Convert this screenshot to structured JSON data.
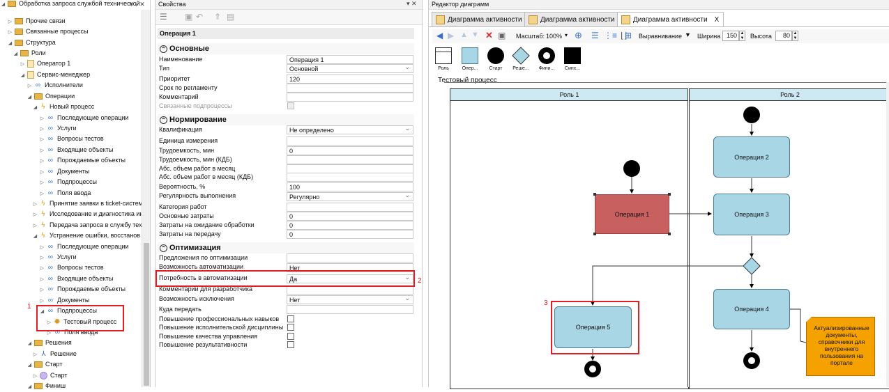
{
  "tree": {
    "top_cut": "Обработка запроса службой технической п",
    "items": [
      {
        "label": "Прочие связи"
      },
      {
        "label": "Связанные процессы"
      },
      {
        "label": "Структура"
      },
      {
        "label": "Роли"
      },
      {
        "label": "Оператор 1"
      },
      {
        "label": "Сервис-менеджер"
      },
      {
        "label": "Исполнители"
      },
      {
        "label": "Операции"
      },
      {
        "label": "Новый процесс"
      },
      {
        "label": "Последующие операции"
      },
      {
        "label": "Услуги"
      },
      {
        "label": "Вопросы тестов"
      },
      {
        "label": "Входящие объекты"
      },
      {
        "label": "Порождаемые объекты"
      },
      {
        "label": "Документы"
      },
      {
        "label": "Подпроцессы"
      },
      {
        "label": "Поля ввода"
      },
      {
        "label": "Принятие заявки в ticket-систем"
      },
      {
        "label": "Исследование и диагностика ин"
      },
      {
        "label": "Передача запроса в службу тех"
      },
      {
        "label": "Устранение ошибки, восстанов"
      },
      {
        "label": "Последующие операции"
      },
      {
        "label": "Услуги"
      },
      {
        "label": "Вопросы тестов"
      },
      {
        "label": "Входящие объекты"
      },
      {
        "label": "Порождаемые объекты"
      },
      {
        "label": "Документы"
      },
      {
        "label": "Подпроцессы"
      },
      {
        "label": "Тестовый процесс"
      },
      {
        "label": "Поля ввода"
      },
      {
        "label": "Решения"
      },
      {
        "label": "Решение"
      },
      {
        "label": "Старт"
      },
      {
        "label": "Старт"
      },
      {
        "label": "Финиш"
      }
    ]
  },
  "annotations": {
    "n1": "1",
    "n2": "2",
    "n3": "3"
  },
  "props": {
    "title": "Свойства",
    "object_name": "Операция 1",
    "sections": {
      "basic": "Основные",
      "norm": "Нормирование",
      "opt": "Оптимизация"
    },
    "basic": [
      {
        "label": "Наименование",
        "value": "Операция 1"
      },
      {
        "label": "Тип",
        "value": "Основной"
      },
      {
        "label": "Приоритет",
        "value": "120"
      },
      {
        "label": "Срок по регламенту",
        "value": ""
      },
      {
        "label": "Комментарий",
        "value": ""
      },
      {
        "label": "Связанные подпроцессы",
        "value": ""
      }
    ],
    "norm": [
      {
        "label": "Квалификация",
        "value": "Не определено"
      },
      {
        "label": "Единица измерения",
        "value": ""
      },
      {
        "label": "Трудоемкость, мин",
        "value": "0"
      },
      {
        "label": "Трудоемкость, мин (КДБ)",
        "value": ""
      },
      {
        "label": "Абс. объем работ в месяц",
        "value": ""
      },
      {
        "label": "Абс. объем работ в месяц (КДБ)",
        "value": ""
      },
      {
        "label": "Вероятность, %",
        "value": "100"
      },
      {
        "label": "Регулярность выполнения",
        "value": "Регулярно"
      },
      {
        "label": "Категория работ",
        "value": ""
      },
      {
        "label": "Основные затраты",
        "value": "0"
      },
      {
        "label": "Затраты на ожидание обработки",
        "value": "0"
      },
      {
        "label": "Затраты на передачу",
        "value": "0"
      }
    ],
    "opt": [
      {
        "label": "Предложения по оптимизации",
        "value": ""
      },
      {
        "label": "Возможность автоматизации",
        "value": "Нет"
      },
      {
        "label": "Потребность в автоматизации",
        "value": "Да"
      },
      {
        "label": "Комментарии для разработчика",
        "value": ""
      },
      {
        "label": "Возможность исключения",
        "value": "Нет"
      },
      {
        "label": "Куда передать",
        "value": ""
      },
      {
        "label": "Повышение профессиональных навыков",
        "value": ""
      },
      {
        "label": "Повышение исполнительской дисциплины",
        "value": ""
      },
      {
        "label": "Повышение качества управления",
        "value": ""
      },
      {
        "label": "Повышение результативности",
        "value": ""
      }
    ]
  },
  "editor": {
    "title": "Редактор диаграмм",
    "tabs": [
      {
        "label": "Диаграмма активности",
        "close": "X"
      },
      {
        "label": "Диаграмма активности",
        "close": "X"
      },
      {
        "label": "Диаграмма активности",
        "close": "X"
      }
    ],
    "toolbar": {
      "scale_label": "Масштаб:",
      "scale_value": "100%",
      "align_label": "Выравнивание",
      "width_label": "Ширина",
      "width_value": "150",
      "height_label": "Высота",
      "height_value": "80"
    },
    "palette": [
      "Роль",
      "Опер...",
      "Старт",
      "Реше...",
      "Фини...",
      "Синх..."
    ],
    "diagram": {
      "title": "Тестовый процесс",
      "lanes": [
        "Роль 1",
        "Роль 2"
      ],
      "nodes": {
        "op1": "Операция 1",
        "op2": "Операция 2",
        "op3": "Операция 3",
        "op4": "Операция 4",
        "op5": "Операция 5",
        "doc": "Актуализированные документы, справочники для внутреннего пользования на портале"
      },
      "colors": {
        "op_fill": "#a9d6e4",
        "op1_fill": "#c96060",
        "doc_fill": "#f5a200"
      }
    }
  }
}
